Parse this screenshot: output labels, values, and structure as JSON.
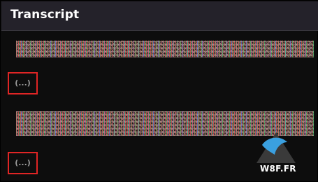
{
  "panel": {
    "title": "Transcript"
  },
  "entries": [
    {
      "placeholder": "(...)"
    },
    {
      "placeholder": "(...)"
    }
  ],
  "watermark": {
    "text": "W8F.FR"
  },
  "colors": {
    "header_bg": "#24222a",
    "panel_bg": "#0d0d0d",
    "highlight_border": "#e02525",
    "logo_blue": "#3aa0e0"
  }
}
